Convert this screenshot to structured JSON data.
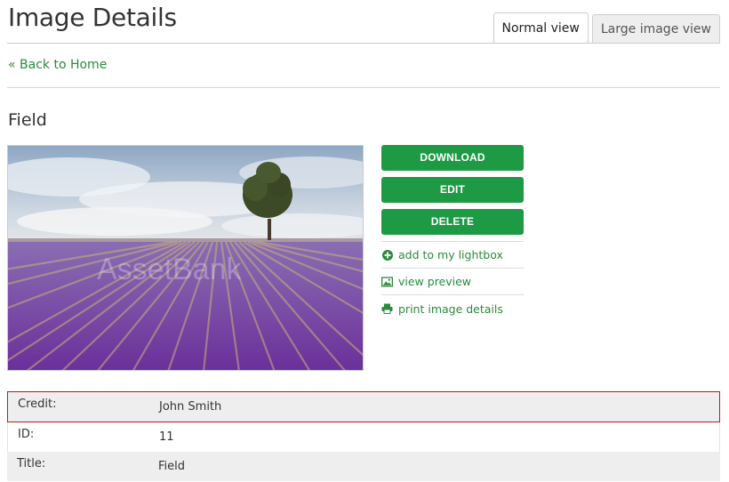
{
  "page": {
    "title": "Image Details"
  },
  "tabs": [
    {
      "label": "Normal view",
      "active": true
    },
    {
      "label": "Large image view",
      "active": false
    }
  ],
  "nav": {
    "back_link": "« Back to Home"
  },
  "asset": {
    "title": "Field",
    "watermark": "AssetBank"
  },
  "actions": {
    "download": "DOWNLOAD",
    "edit": "EDIT",
    "delete": "DELETE",
    "links": [
      {
        "label": "add to my lightbox",
        "icon": "plus-circle-icon"
      },
      {
        "label": "view preview",
        "icon": "image-icon"
      },
      {
        "label": "print image details",
        "icon": "printer-icon"
      }
    ]
  },
  "details": [
    {
      "label": "Credit:",
      "value": "John Smith"
    },
    {
      "label": "ID:",
      "value": "11"
    },
    {
      "label": "Title:",
      "value": "Field"
    }
  ],
  "colors": {
    "accent": "#1e9a45",
    "link": "#2a8a3a",
    "highlight_border": "#b81c1c"
  }
}
